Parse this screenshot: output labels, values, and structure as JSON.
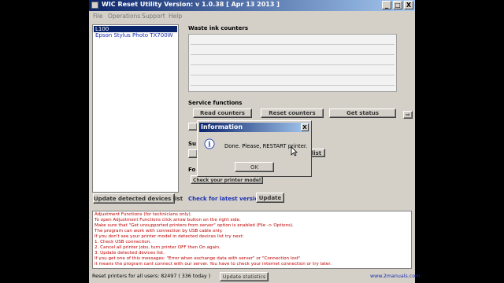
{
  "window": {
    "title": "WIC Reset Utility  Version: v 1.0.38 [ Apr 13 2013 ]",
    "minimize": "_",
    "maximize": "□",
    "close": "X"
  },
  "menu": [
    "File",
    "Operations",
    "Support",
    "Help"
  ],
  "printers": [
    "L100",
    "Epson Stylus Photo TX700W"
  ],
  "waste_ink": {
    "label": "Waste ink counters"
  },
  "service": {
    "label": "Service functions",
    "read_counters": "Read counters",
    "reset_counters": "Reset counters",
    "get_status": "Get status"
  },
  "partial": {
    "su": "Su",
    "fo": "Fo",
    "list": "list",
    "check_model": "Check your printer model"
  },
  "update_devices": "Update detected devices list",
  "check_version": "Check for latest version",
  "update": "Update",
  "help_lines": [
    "Adjustment Functions (for technicians only).",
    "To open Adjustment Functions click arrow button on the right side.",
    "Make sure that \"Get unsupported printers from server\" option is enabled (File -> Options).",
    "The program can work with connection by USB cable only.",
    "If you don't see your printer model in detected devices list try next:",
    "  1. Check USB connection.",
    "  2. Cancel all printer jobs, turn printer OFF then On again.",
    "  3. Update detected devices list.",
    "If you get one of this messages: \"Error when exchange data with server\" or \"Connection lost\"",
    "it means the program cant connect with our server. You have to check your internet connection or try later."
  ],
  "status": {
    "reset_text": "Reset printers for all users: 82497 ( 336 today )",
    "update_statistics": "Update statistics",
    "website": "www.2manuals.com"
  },
  "dialog": {
    "title": "Information",
    "close": "X",
    "message": "Done. Please, RESTART printer.",
    "ok": "OK"
  }
}
